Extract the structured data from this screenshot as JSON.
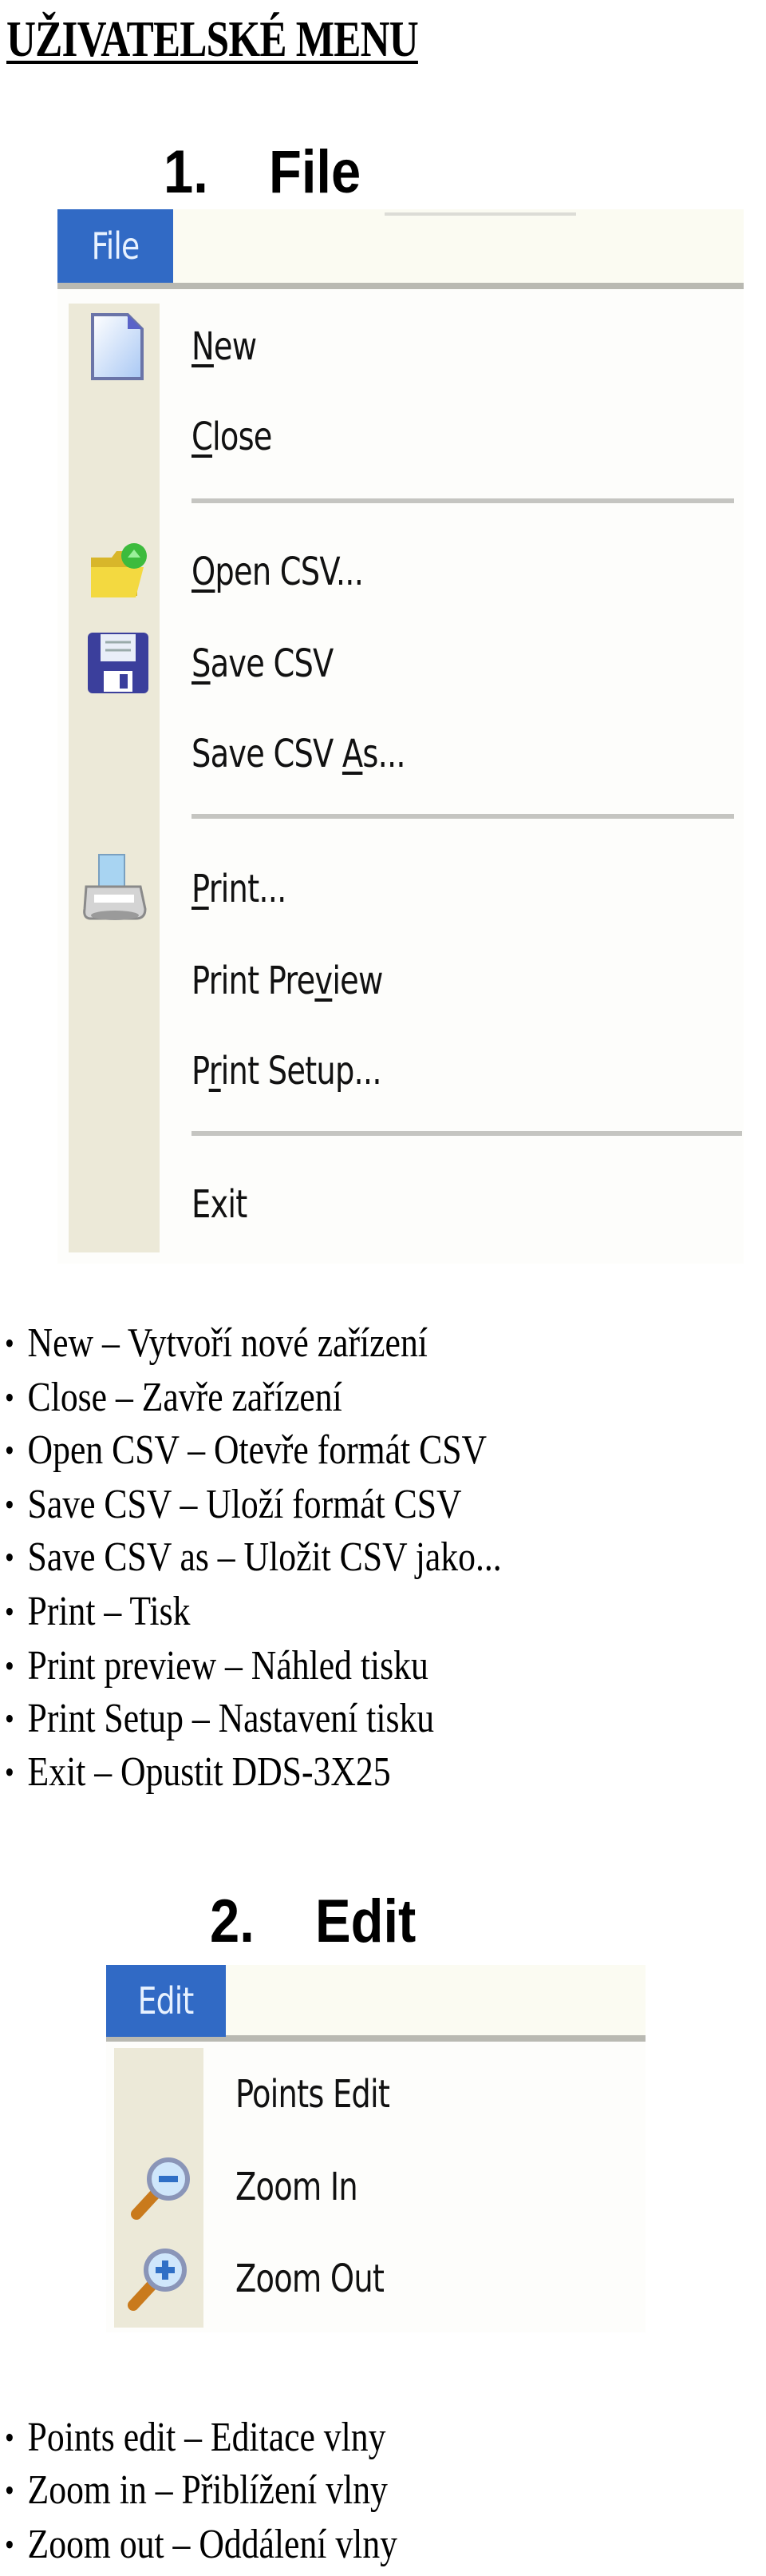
{
  "page_title": "UŽIVATELSKÉ MENU",
  "sections": [
    {
      "number": "1.",
      "name": "File",
      "menu_tab_label": "File",
      "items": [
        {
          "pre": "",
          "key": "N",
          "post": "ew",
          "icon": "new-document-icon"
        },
        {
          "pre": "",
          "key": "C",
          "post": "lose",
          "icon": ""
        },
        {
          "separator": true
        },
        {
          "pre": "",
          "key": "O",
          "post": "pen CSV...",
          "icon": "open-folder-icon"
        },
        {
          "pre": "",
          "key": "S",
          "post": "ave CSV",
          "icon": "floppy-disk-icon"
        },
        {
          "pre": "Save CSV ",
          "key": "A",
          "post": "s...",
          "icon": ""
        },
        {
          "separator": true
        },
        {
          "pre": "",
          "key": "P",
          "post": "rint...",
          "icon": "printer-icon"
        },
        {
          "pre": "Print Pre",
          "key": "v",
          "post": "iew",
          "icon": ""
        },
        {
          "pre": "P",
          "key": "r",
          "post": "int Setup...",
          "icon": ""
        },
        {
          "separator": true
        },
        {
          "pre": "Exit",
          "key": "",
          "post": "",
          "icon": ""
        }
      ],
      "descriptions": [
        "New – Vytvoří nové zařízení",
        "Close – Zavře zařízení",
        "Open CSV – Otevře formát CSV",
        "Save CSV – Uloží formát CSV",
        "Save CSV as – Uložit CSV jako...",
        "Print – Tisk",
        "Print preview – Náhled tisku",
        "Print Setup – Nastavení tisku",
        "Exit – Opustit DDS-3X25"
      ]
    },
    {
      "number": "2.",
      "name": "Edit",
      "menu_tab_label": "Edit",
      "items": [
        {
          "pre": "Points Edit",
          "key": "",
          "post": "",
          "icon": ""
        },
        {
          "pre": "Zoom In",
          "key": "",
          "post": "",
          "icon": "zoom-in-magnifier-icon"
        },
        {
          "pre": "Zoom Out",
          "key": "",
          "post": "",
          "icon": "zoom-out-magnifier-icon"
        }
      ],
      "descriptions": [
        "Points edit – Editace vlny",
        "Zoom in – Přiblížení vlny",
        "Zoom out – Oddálení vlny"
      ]
    }
  ],
  "bullet_glyph": "•",
  "colors": {
    "menu_highlight": "#316ac5",
    "icon_column": "#ece9d8",
    "separator": "#c5c5c1"
  }
}
